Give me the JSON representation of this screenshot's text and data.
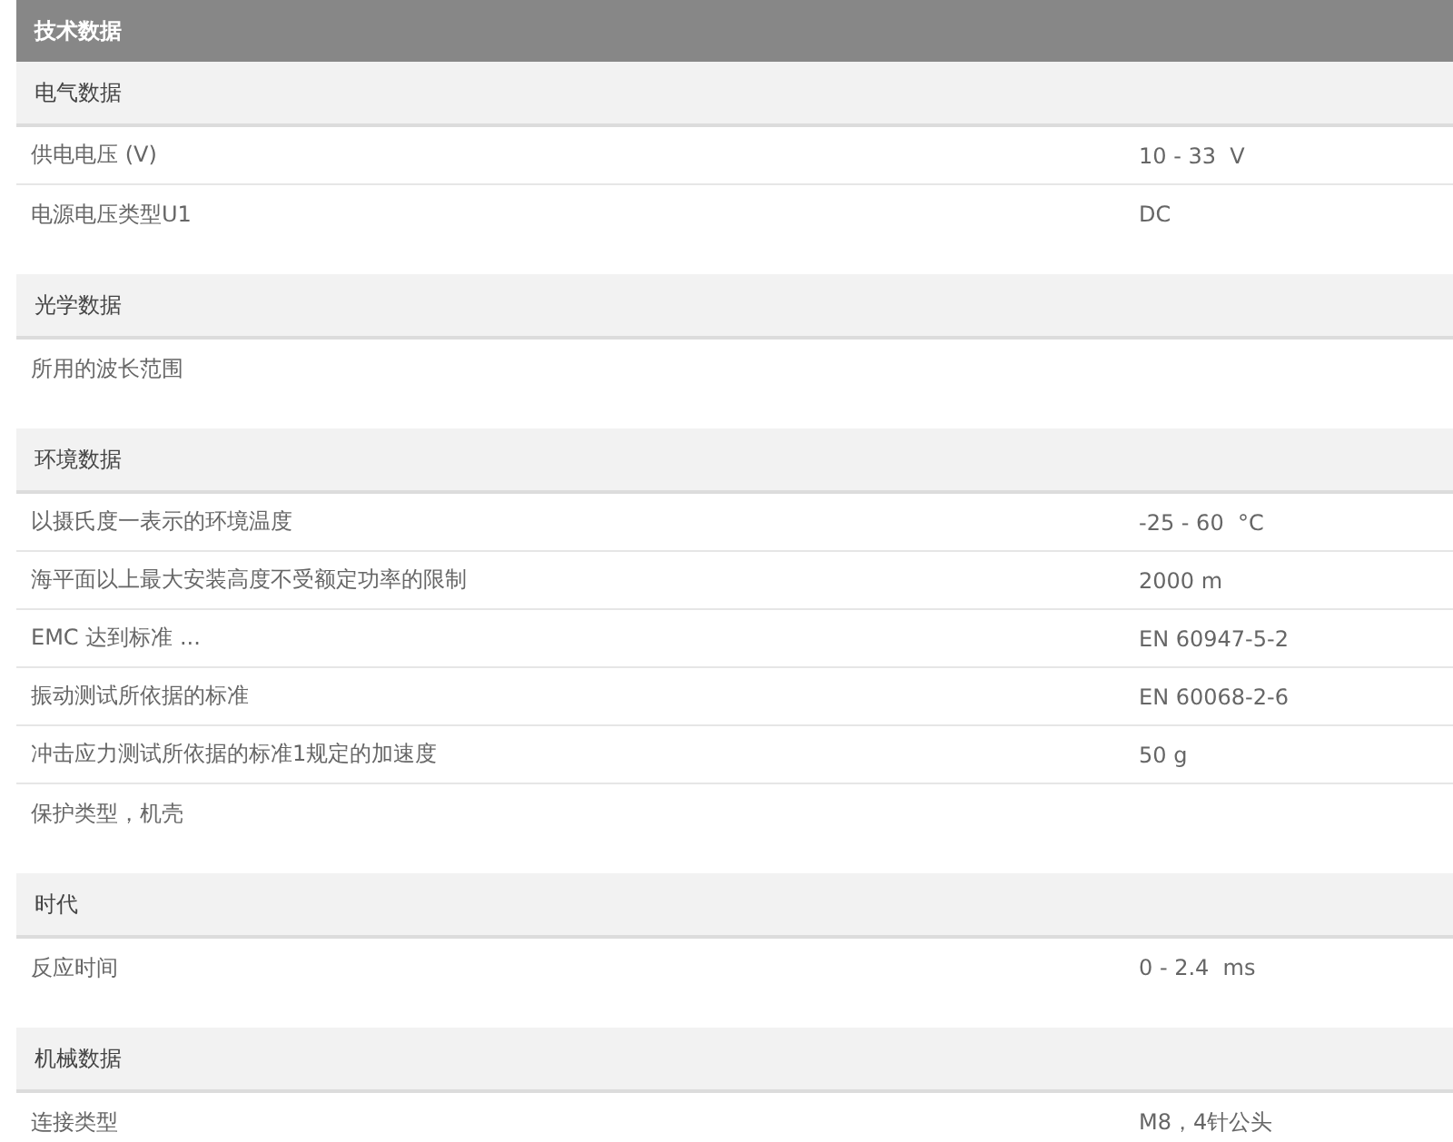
{
  "title": "技术数据",
  "sections": [
    {
      "title": "电气数据",
      "rows": [
        {
          "label": "供电电压 (V)",
          "value": "10 - 33  V"
        },
        {
          "label": "电源电压类型U1",
          "value": "DC"
        }
      ]
    },
    {
      "title": "光学数据",
      "rows": [
        {
          "label": "所用的波长范围"
        }
      ]
    },
    {
      "title": "环境数据",
      "rows": [
        {
          "label": "以摄氏度一表示的环境温度",
          "value": "-25 - 60  °C"
        },
        {
          "label": "海平面以上最大安装高度不受额定功率的限制",
          "value": "2000 m"
        },
        {
          "label": "EMC 达到标准 ...",
          "value": "EN 60947-5-2"
        },
        {
          "label": "振动测试所依据的标准",
          "value": "EN 60068-2-6"
        },
        {
          "label": "冲击应力测试所依据的标准1规定的加速度",
          "value": "50 g"
        },
        {
          "label": "保护类型，机壳"
        }
      ]
    },
    {
      "title": "时代",
      "rows": [
        {
          "label": "反应时间",
          "value": "0 - 2.4  ms"
        }
      ]
    },
    {
      "title": "机械数据",
      "rows": [
        {
          "label": "连接类型",
          "value": "M8，4针公头"
        }
      ]
    }
  ]
}
